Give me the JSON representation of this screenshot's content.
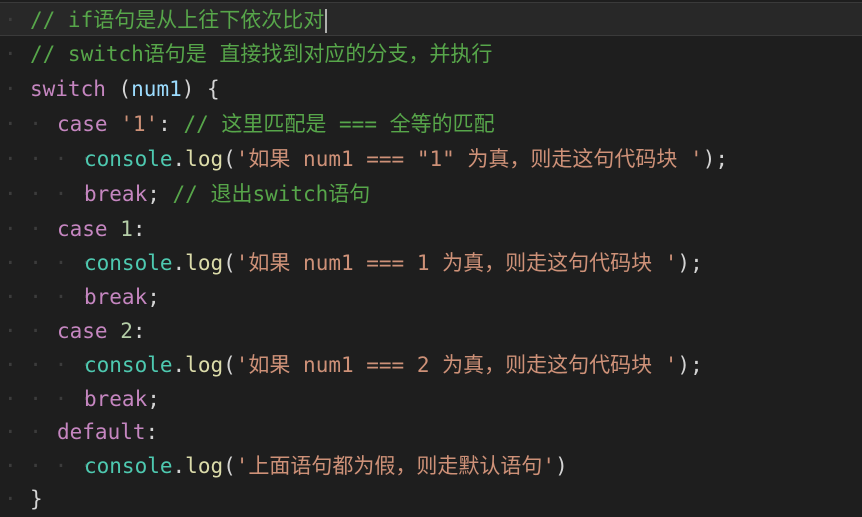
{
  "whitespace_dots": {
    "level0": "·",
    "level1": "· ·",
    "level2": "· · · ·"
  },
  "lines": [
    {
      "comment": "// if语句是从上往下依次比对"
    },
    {
      "comment": "// switch语句是 直接找到对应的分支，并执行"
    },
    {
      "kw": "switch",
      "open": " (",
      "var": "num1",
      "close": ") {"
    },
    {
      "kw": "case",
      "sp": " ",
      "str": "'1'",
      "colon": ": ",
      "comment": "// 这里匹配是 === 全等的匹配"
    },
    {
      "obj": "console",
      "dot": ".",
      "fn": "log",
      "open": "(",
      "str": "'如果 num1 === \"1\" 为真，则走这句代码块 '",
      "close": ");"
    },
    {
      "kw": "break",
      "semi": "; ",
      "comment": "// 退出switch语句"
    },
    {
      "kw": "case",
      "sp": " ",
      "num": "1",
      "colon": ":"
    },
    {
      "obj": "console",
      "dot": ".",
      "fn": "log",
      "open": "(",
      "str": "'如果 num1 === 1 为真，则走这句代码块 '",
      "close": ");"
    },
    {
      "kw": "break",
      "semi": ";"
    },
    {
      "kw": "case",
      "sp": " ",
      "num": "2",
      "colon": ":"
    },
    {
      "obj": "console",
      "dot": ".",
      "fn": "log",
      "open": "(",
      "str": "'如果 num1 === 2 为真，则走这句代码块 '",
      "close": ");"
    },
    {
      "kw": "break",
      "semi": ";"
    },
    {
      "kw": "default",
      "colon": ":"
    },
    {
      "obj": "console",
      "dot": ".",
      "fn": "log",
      "open": "(",
      "str": "'上面语句都为假，则走默认语句'",
      "close": ")"
    },
    {
      "close": "}"
    }
  ]
}
